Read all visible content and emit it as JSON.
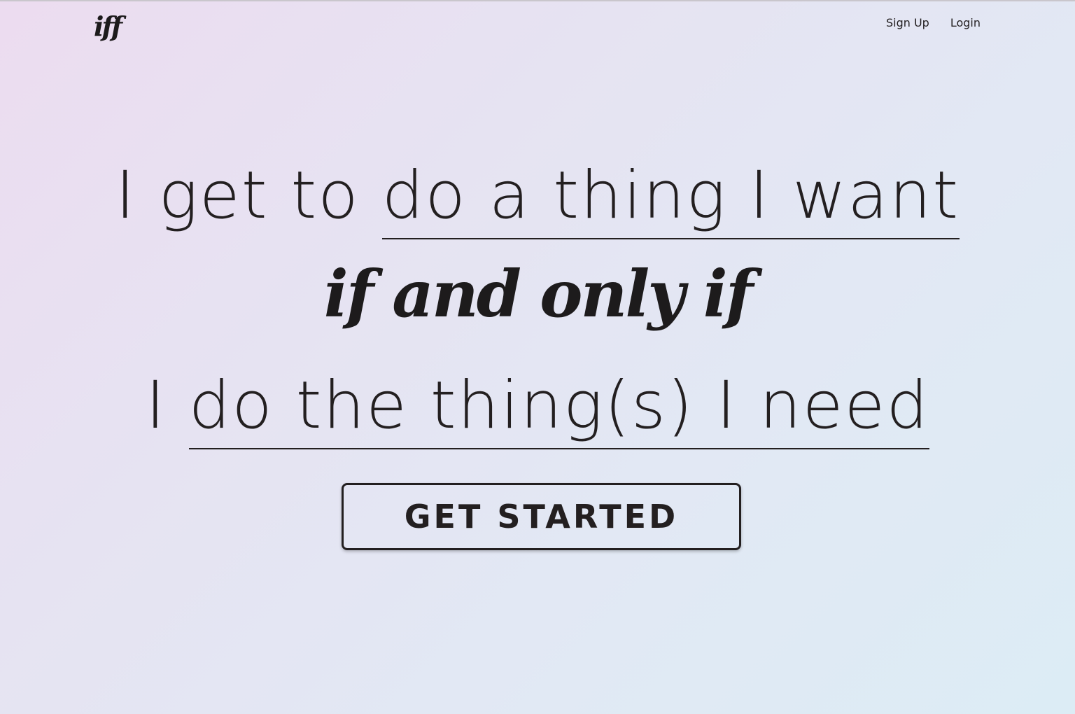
{
  "header": {
    "logo_text": "iff",
    "nav": {
      "signup_label": "Sign Up",
      "login_label": "Login"
    }
  },
  "hero": {
    "line1_prefix": "I get to ",
    "line1_underlined": "do a thing I want",
    "connector": "if and only if",
    "line3_prefix": "I ",
    "line3_underlined": "do the thing(s) I need",
    "cta_label": "GET STARTED"
  },
  "colors": {
    "text": "#231f20",
    "background_start": "#ecdcf0",
    "background_end": "#dcecf5"
  }
}
